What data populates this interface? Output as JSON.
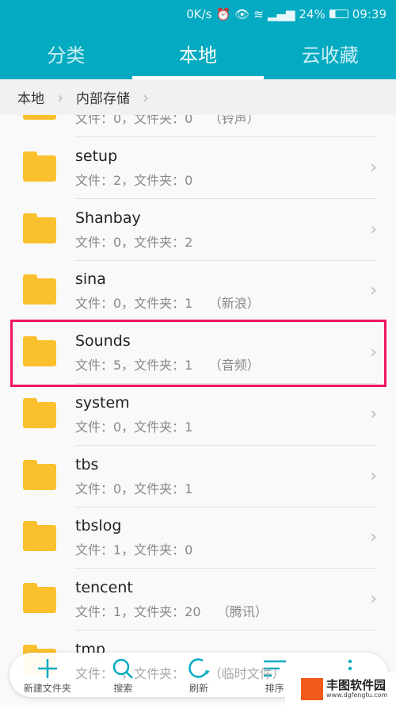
{
  "status_bar": {
    "speed": "0K/s",
    "battery": "24%",
    "time": "09:39"
  },
  "tabs": [
    {
      "label": "分类"
    },
    {
      "label": "本地",
      "active": true
    },
    {
      "label": "云收藏"
    }
  ],
  "breadcrumb": [
    "本地",
    "内部存储"
  ],
  "folders": [
    {
      "name": "",
      "meta": "文件：0，文件夹：0    （铃声）"
    },
    {
      "name": "setup",
      "meta": "文件：2，文件夹：0"
    },
    {
      "name": "Shanbay",
      "meta": "文件：0，文件夹：2"
    },
    {
      "name": "sina",
      "meta": "文件：0，文件夹：1    （新浪）"
    },
    {
      "name": "Sounds",
      "meta": "文件：5，文件夹：1    （音频）",
      "highlighted": true
    },
    {
      "name": "system",
      "meta": "文件：0，文件夹：1"
    },
    {
      "name": "tbs",
      "meta": "文件：0，文件夹：1"
    },
    {
      "name": "tbslog",
      "meta": "文件：1，文件夹：0"
    },
    {
      "name": "tencent",
      "meta": "文件：1，文件夹：20    （腾讯）"
    },
    {
      "name": "tmp",
      "meta": "文件：  ，文件夹：      （临时文件）"
    }
  ],
  "toolbar": {
    "new_folder": "新建文件夹",
    "search": "搜索",
    "refresh": "刷新",
    "sort": "排序"
  },
  "watermark": {
    "name": "丰图软件园",
    "url": "www.dgfengtu.com"
  },
  "colors": {
    "primary": "#04aac1",
    "highlight": "#f0165d",
    "folder": "#fbc02d"
  }
}
